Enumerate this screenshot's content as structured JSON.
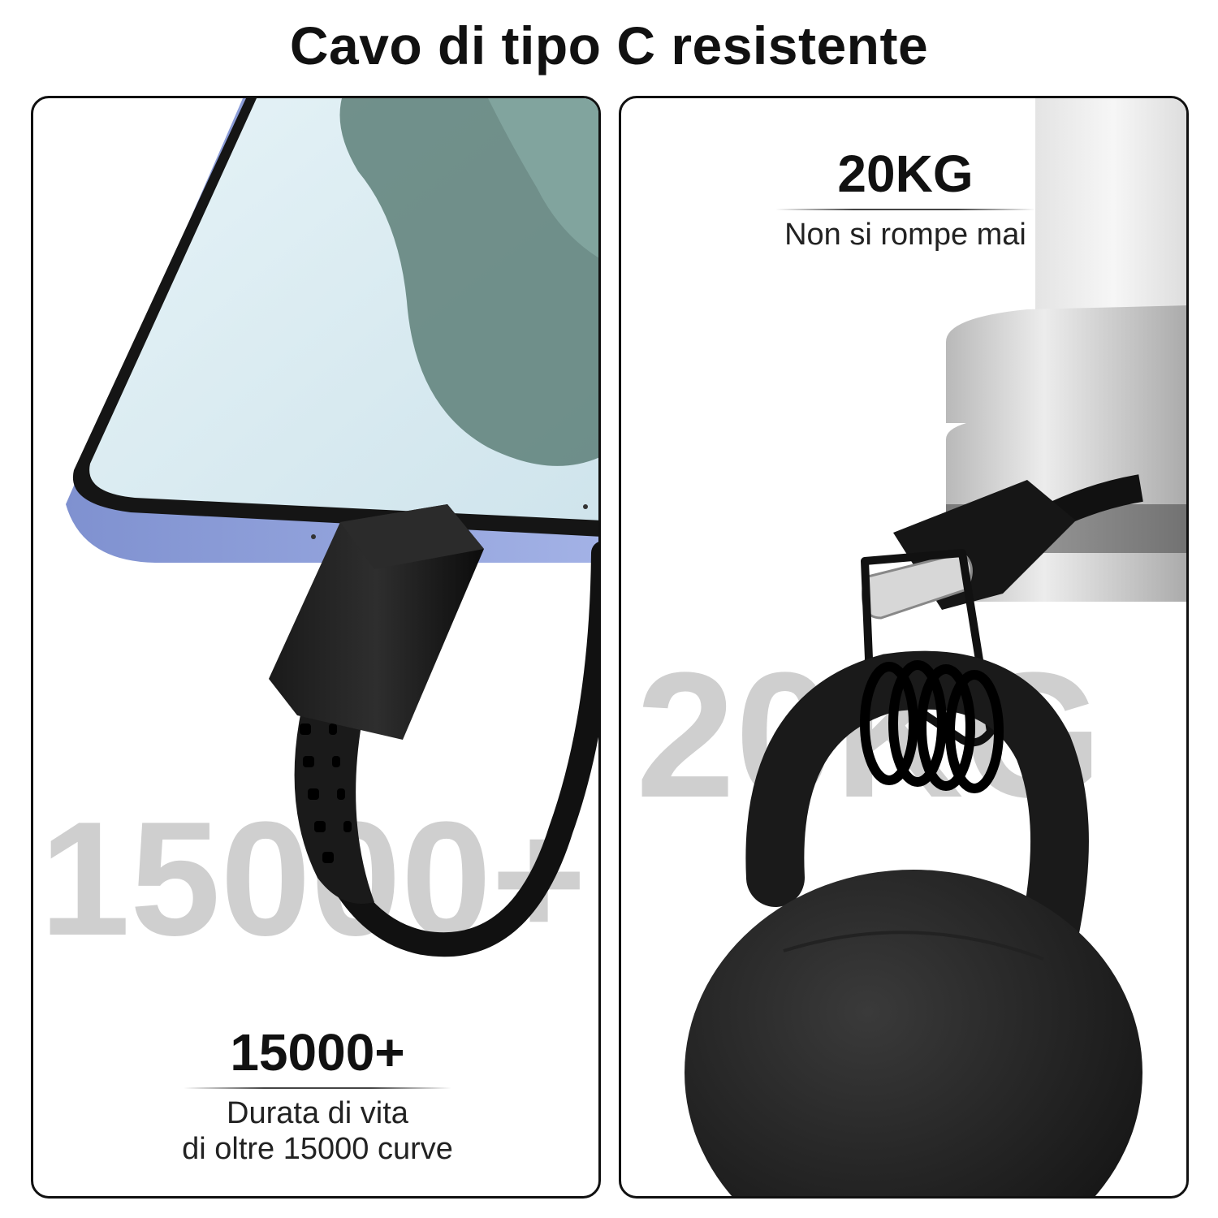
{
  "title": "Cavo di tipo C resistente",
  "left_panel": {
    "watermark": "15000+",
    "headline": "15000+",
    "desc_line1": "Durata di vita",
    "desc_line2": "di oltre 15000 curve"
  },
  "right_panel": {
    "watermark": "20KG",
    "headline": "20KG",
    "desc_line1": "Non si rompe mai"
  },
  "colors": {
    "phone_frame": "#8a9bd8",
    "screen": "#d9ecf3",
    "cable": "#111111",
    "watermark": "#cfcfcf",
    "metal": "#c9c9c9"
  }
}
